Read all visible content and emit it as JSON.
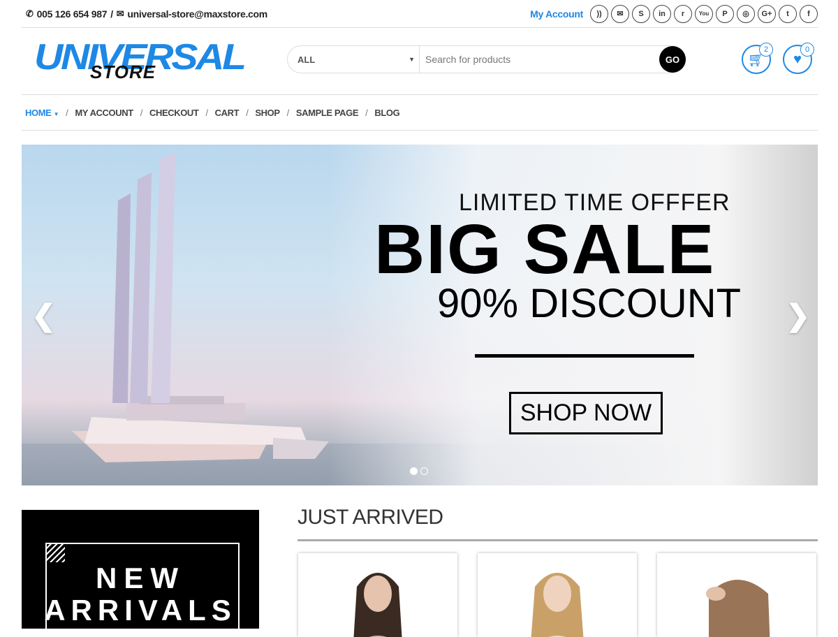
{
  "topbar": {
    "phone": "005 126 654 987",
    "separator": "/",
    "email": "universal-store@maxstore.com",
    "my_account": "My Account",
    "social_icons": [
      "rss-icon",
      "envelope-icon",
      "skype-icon",
      "linkedin-icon",
      "reddit-icon",
      "youtube-icon",
      "pinterest-icon",
      "instagram-icon",
      "google-plus-icon",
      "twitter-icon",
      "facebook-icon"
    ],
    "social_glyphs": [
      "))",
      "✉",
      "S",
      "in",
      "r",
      "You",
      "P",
      "◎",
      "G+",
      "t",
      "f"
    ]
  },
  "header": {
    "logo_main": "UNIVERSAL",
    "logo_sub": "STORE",
    "category": "ALL",
    "search_placeholder": "Search for products",
    "go_label": "GO",
    "cart_count": "2",
    "wishlist_count": "0"
  },
  "nav": {
    "items": [
      "HOME",
      "MY ACCOUNT",
      "CHECKOUT",
      "CART",
      "SHOP",
      "SAMPLE PAGE",
      "BLOG"
    ]
  },
  "hero": {
    "kicker": "LIMITED TIME OFFFER",
    "headline": "BIG SALE",
    "discount": "90% DISCOUNT",
    "cta": "SHOP NOW",
    "slide_count": 2,
    "active_slide": 1
  },
  "promo": {
    "line1": "NEW",
    "line2": "ARRIVALS"
  },
  "section": {
    "title": "JUST ARRIVED"
  },
  "colors": {
    "accent": "#1e88e5",
    "dark": "#000000"
  }
}
